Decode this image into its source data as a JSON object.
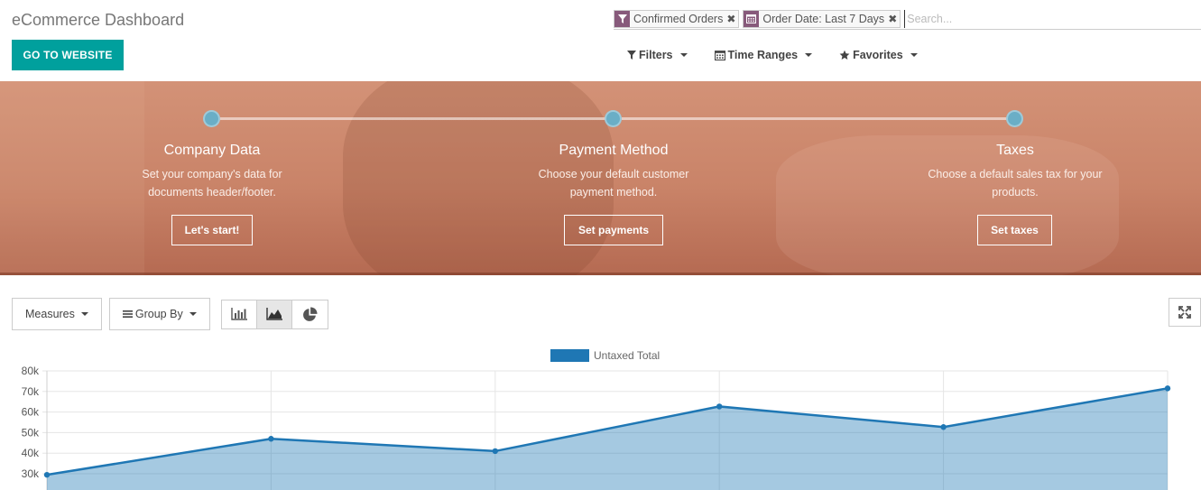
{
  "header": {
    "title": "eCommerce Dashboard",
    "website_button": "GO TO WEBSITE"
  },
  "search": {
    "facets": [
      {
        "icon": "filter-icon",
        "label": "Confirmed Orders"
      },
      {
        "icon": "calendar-icon",
        "label": "Order Date: Last 7 Days"
      }
    ],
    "placeholder": "Search..."
  },
  "dropdowns": {
    "filters": "Filters",
    "time_ranges": "Time Ranges",
    "favorites": "Favorites"
  },
  "onboarding": {
    "steps": [
      {
        "title": "Company Data",
        "desc_line1": "Set your company's data for",
        "desc_line2": "documents header/footer.",
        "button": "Let's start!"
      },
      {
        "title": "Payment Method",
        "desc_line1": "Choose your default customer",
        "desc_line2": "payment method.",
        "button": "Set payments"
      },
      {
        "title": "Taxes",
        "desc_line1": "Choose a default sales tax for your",
        "desc_line2": "products.",
        "button": "Set taxes"
      }
    ],
    "colors": {
      "banner": "#c98368",
      "dot": "#6aaec6"
    }
  },
  "graph_controls": {
    "measures": "Measures",
    "group_by": "Group By",
    "views": [
      {
        "icon": "bar-chart-icon",
        "active": false
      },
      {
        "icon": "line-chart-icon",
        "active": true
      },
      {
        "icon": "pie-chart-icon",
        "active": false
      }
    ]
  },
  "chart_data": {
    "type": "area",
    "series": [
      {
        "name": "Untaxed Total",
        "values": [
          29500,
          47000,
          41000,
          62700,
          52700,
          71500
        ],
        "color": "#1f77b4"
      }
    ],
    "y_ticks": [
      "80k",
      "70k",
      "60k",
      "50k",
      "40k",
      "30k"
    ],
    "ylim": [
      27000,
      80000
    ],
    "grid": true,
    "legend": "top-center"
  },
  "colors": {
    "accent": "#00A09D",
    "facet": "#875A7B"
  }
}
